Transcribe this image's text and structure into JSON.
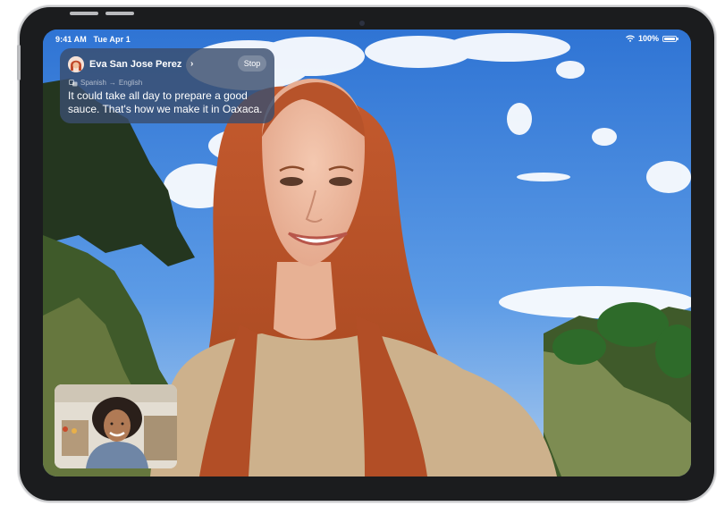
{
  "status_bar": {
    "time": "9:41 AM",
    "date": "Tue Apr 1",
    "battery": "100%"
  },
  "banner": {
    "caller_name": "Eva San Jose Perez",
    "chevron": "›",
    "stop_label": "Stop",
    "source_language": "Spanish",
    "arrow": "→",
    "target_language": "English",
    "caption": "It could take all day to prepare a good sauce. That's how we make it in Oaxaca."
  },
  "icons": {
    "wifi": "wifi-icon",
    "battery": "battery-icon",
    "translate": "translate-icon",
    "avatar": "memoji-avatar"
  },
  "colors": {
    "banner_bg": "#3a4e6e",
    "sky": "#3a7fd6",
    "hair": "#b8552c",
    "sweater": "#c9ad88"
  }
}
